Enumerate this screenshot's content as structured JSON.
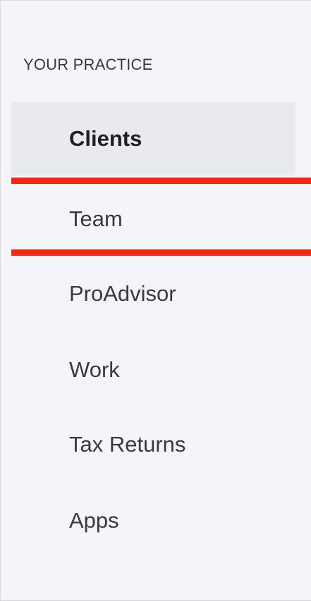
{
  "sidebar": {
    "section_title": "YOUR PRACTICE",
    "items": [
      {
        "label": "Clients",
        "active": true
      },
      {
        "label": "Team",
        "highlighted": true
      },
      {
        "label": "ProAdvisor"
      },
      {
        "label": "Work"
      },
      {
        "label": "Tax Returns"
      },
      {
        "label": "Apps"
      }
    ]
  },
  "colors": {
    "panel_background": "#f4f5f8",
    "active_item_background": "#e9eaee",
    "text": "#393a3d",
    "highlight_marker": "#f1290f"
  }
}
